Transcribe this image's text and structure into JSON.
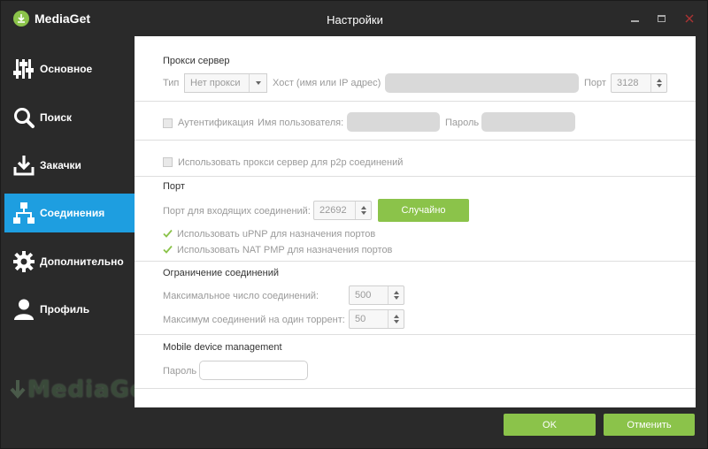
{
  "app": {
    "name": "MediaGet",
    "window_title": "Настройки"
  },
  "sidebar": {
    "items": [
      {
        "label": "Основное",
        "icon": "sliders-icon"
      },
      {
        "label": "Поиск",
        "icon": "magnifier-icon"
      },
      {
        "label": "Закачки",
        "icon": "download-icon"
      },
      {
        "label": "Соединения",
        "icon": "network-icon",
        "active": true
      },
      {
        "label": "Дополнительно",
        "icon": "gear-icon"
      },
      {
        "label": "Профиль",
        "icon": "user-icon"
      }
    ],
    "watermark": "MediaGet"
  },
  "proxy": {
    "title": "Прокси сервер",
    "type_label": "Тип",
    "type_value": "Нет прокси",
    "host_label": "Хост (имя или IP адрес)",
    "port_label": "Порт",
    "port_value": "3128",
    "auth_label": "Аутентификация",
    "username_label": "Имя пользователя:",
    "password_label": "Пароль",
    "p2p_label": "Использовать прокси сервер для p2p соединений"
  },
  "port": {
    "title": "Порт",
    "incoming_label": "Порт для входящих соединений:",
    "incoming_value": "22692",
    "random_button": "Случайно",
    "upnp_label": "Использовать uPNP для назначения портов",
    "natpmp_label": "Использовать NAT PMP для назначения портов"
  },
  "limits": {
    "title": "Ограничение соединений",
    "max_label": "Максимальное число соединений:",
    "max_value": "500",
    "per_torrent_label": "Максимум соединений на один торрент:",
    "per_torrent_value": "50"
  },
  "mobile": {
    "title": "Mobile device management",
    "password_label": "Пароль"
  },
  "footer": {
    "ok": "OK",
    "cancel": "Отменить"
  },
  "colors": {
    "accent_blue": "#1e9ee0",
    "green": "#8bc34a",
    "dark_bg": "#2a2a2a"
  }
}
